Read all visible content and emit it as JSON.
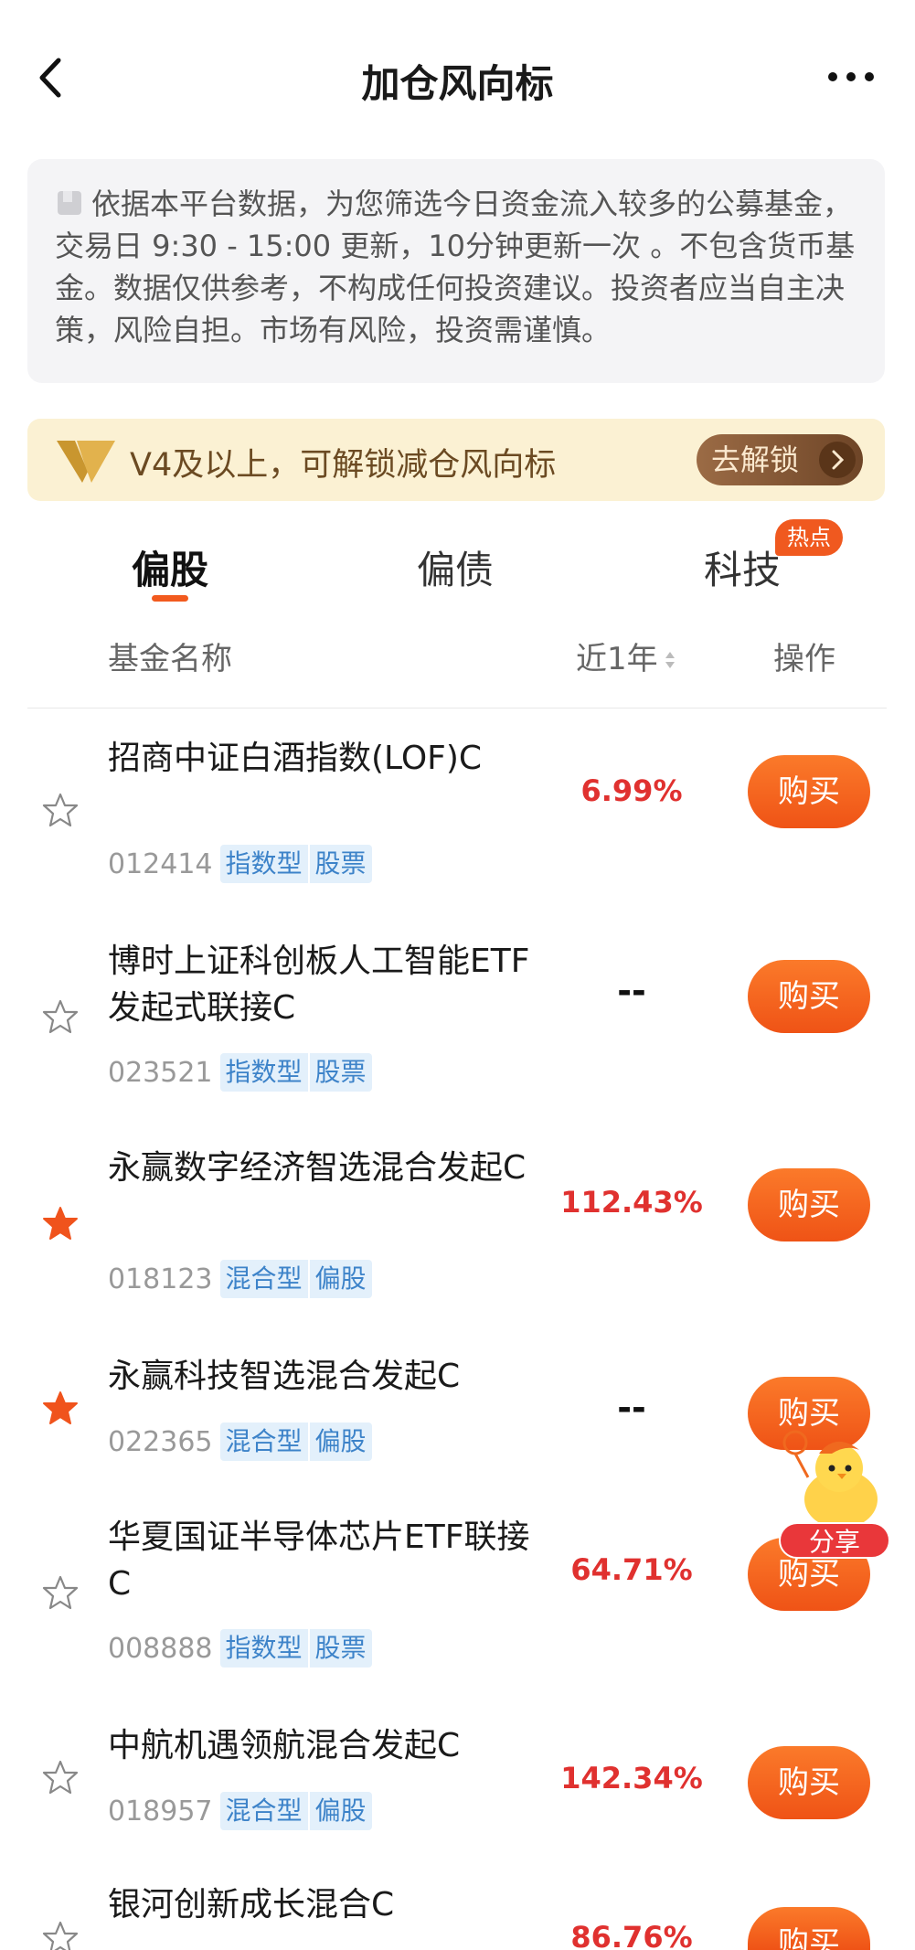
{
  "header": {
    "title": "加仓风向标"
  },
  "notice": {
    "text": "依据本平台数据，为您筛选今日资金流入较多的公募基金，交易日 9:30 - 15:00 更新，10分钟更新一次 。不包含货币基金。数据仅供参考，不构成任何投资建议。投资者应当自主决策，风险自担。市场有风险，投资需谨慎。"
  },
  "unlock": {
    "text": "V4及以上，可解锁减仓风向标",
    "button": "去解锁"
  },
  "tabs": [
    {
      "label": "偏股",
      "active": true
    },
    {
      "label": "偏债",
      "active": false
    },
    {
      "label": "科技",
      "active": false,
      "badge": "热点"
    }
  ],
  "columns": {
    "name": "基金名称",
    "return": "近1年",
    "action": "操作"
  },
  "funds": [
    {
      "name": "招商中证白酒指数(LOF)C",
      "code": "012414",
      "tag1": "指数型",
      "tag2": "股票",
      "return": "6.99%",
      "starred": false,
      "buy": "购买"
    },
    {
      "name": "博时上证科创板人工智能ETF发起式联接C",
      "code": "023521",
      "tag1": "指数型",
      "tag2": "股票",
      "return": "--",
      "starred": false,
      "buy": "购买"
    },
    {
      "name": "永赢数字经济智选混合发起C",
      "code": "018123",
      "tag1": "混合型",
      "tag2": "偏股",
      "return": "112.43%",
      "starred": true,
      "buy": "购买"
    },
    {
      "name": "永赢科技智选混合发起C",
      "code": "022365",
      "tag1": "混合型",
      "tag2": "偏股",
      "return": "--",
      "starred": true,
      "buy": "购买"
    },
    {
      "name": "华夏国证半导体芯片ETF联接C",
      "code": "008888",
      "tag1": "指数型",
      "tag2": "股票",
      "return": "64.71%",
      "starred": false,
      "buy": "购买"
    },
    {
      "name": "中航机遇领航混合发起C",
      "code": "018957",
      "tag1": "混合型",
      "tag2": "偏股",
      "return": "142.34%",
      "starred": false,
      "buy": "购买"
    },
    {
      "name": "银河创新成长混合C",
      "code": "",
      "tag1": "",
      "tag2": "",
      "return": "86.76%",
      "starred": false,
      "buy": "购买"
    }
  ],
  "share": {
    "label": "分享"
  },
  "colors": {
    "accent": "#f25a1e",
    "return_up": "#e0312f",
    "tag_bg": "#e3f0fb",
    "tag_text": "#3d83c9"
  }
}
